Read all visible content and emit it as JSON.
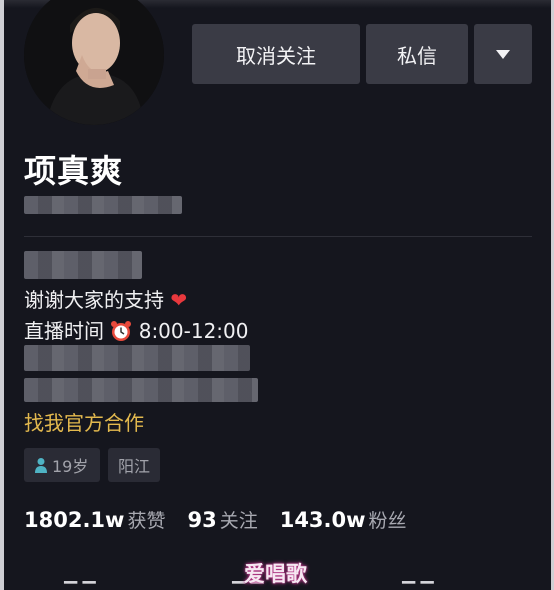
{
  "header": {
    "unfollow_label": "取消关注",
    "message_label": "私信"
  },
  "profile": {
    "name": "项真爽",
    "bio_line1": "谢谢大家的支持",
    "bio_line2_prefix": "直播时间",
    "bio_line2_time": "8:00-12:00",
    "cooperate_link": "找我官方合作",
    "age_tag": "19岁",
    "city_tag": "阳江"
  },
  "stats": {
    "likes_value": "1802.1w",
    "likes_label": "获赞",
    "following_value": "93",
    "following_label": "关注",
    "followers_value": "143.0w",
    "followers_label": "粉丝"
  },
  "watermark": "爱唱歌",
  "colors": {
    "background": "#15161e",
    "button": "#3a3b45",
    "accent_gold": "#e3b94e",
    "heart_red": "#e8383d"
  },
  "icons": [
    "heart-icon",
    "alarm-clock-icon",
    "person-icon",
    "chevron-down-icon"
  ]
}
